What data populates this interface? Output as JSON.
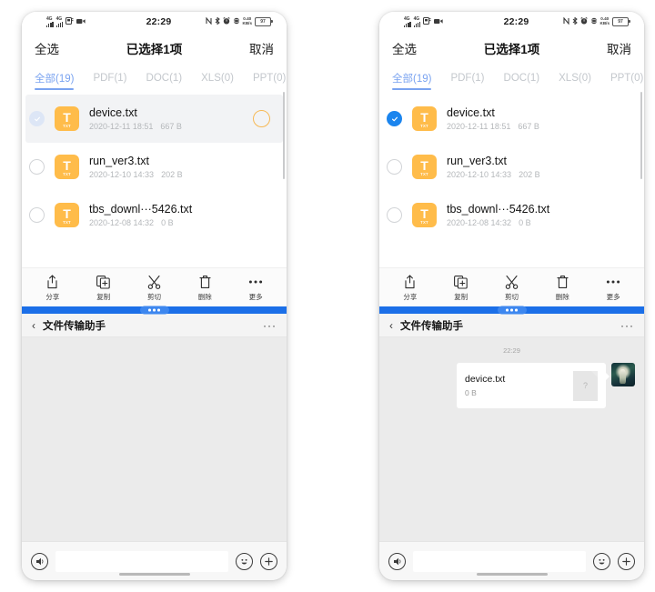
{
  "statusbar": {
    "network_1": "4G",
    "network_2": "4G",
    "time": "22:29",
    "data_rate": "0.40",
    "data_rate_unit": "KB/s",
    "battery": "97",
    "icons": [
      "nfc-icon",
      "bluetooth-icon",
      "alarm-icon",
      "location-icon"
    ]
  },
  "selection_header": {
    "select_all": "全选",
    "title": "已选择1项",
    "cancel": "取消"
  },
  "tabs": [
    {
      "label": "全部(19)",
      "active": true
    },
    {
      "label": "PDF(1)",
      "active": false
    },
    {
      "label": "DOC(1)",
      "active": false
    },
    {
      "label": "XLS(0)",
      "active": false
    },
    {
      "label": "PPT(0)",
      "active": false
    }
  ],
  "files": [
    {
      "name": "device.txt",
      "date": "2020-12-11 18:51",
      "size": "667 B",
      "ext": "TXT",
      "letter": "T"
    },
    {
      "name": "run_ver3.txt",
      "date": "2020-12-10 14:33",
      "size": "202 B",
      "ext": "TXT",
      "letter": "T"
    },
    {
      "name": "tbs_downl···5426.txt",
      "date": "2020-12-08 14:32",
      "size": "0 B",
      "ext": "TXT",
      "letter": "T"
    }
  ],
  "toolbar": [
    {
      "label": "分享",
      "icon": "share-icon"
    },
    {
      "label": "复制",
      "icon": "copy-icon"
    },
    {
      "label": "剪切",
      "icon": "cut-icon"
    },
    {
      "label": "删除",
      "icon": "delete-icon"
    },
    {
      "label": "更多",
      "icon": "more-icon"
    }
  ],
  "chat_header": {
    "back": "‹",
    "title": "文件传输助手",
    "more": "···"
  },
  "chat": {
    "timestamp": "22:29",
    "message": {
      "file_name": "device.txt",
      "file_size": "0 B",
      "thumb_placeholder": "?"
    }
  },
  "input_bar": {
    "voice_icon": "voice-icon",
    "emoji_icon": "emoji-icon",
    "plus_icon": "plus-icon",
    "text_value": ""
  },
  "colors": {
    "accent_blue": "#1b85ee",
    "divider_blue": "#1b6fe8",
    "tab_active": "#7aa3f0",
    "file_icon_orange": "#ffbc4a",
    "ripple_orange": "#f7b955"
  }
}
